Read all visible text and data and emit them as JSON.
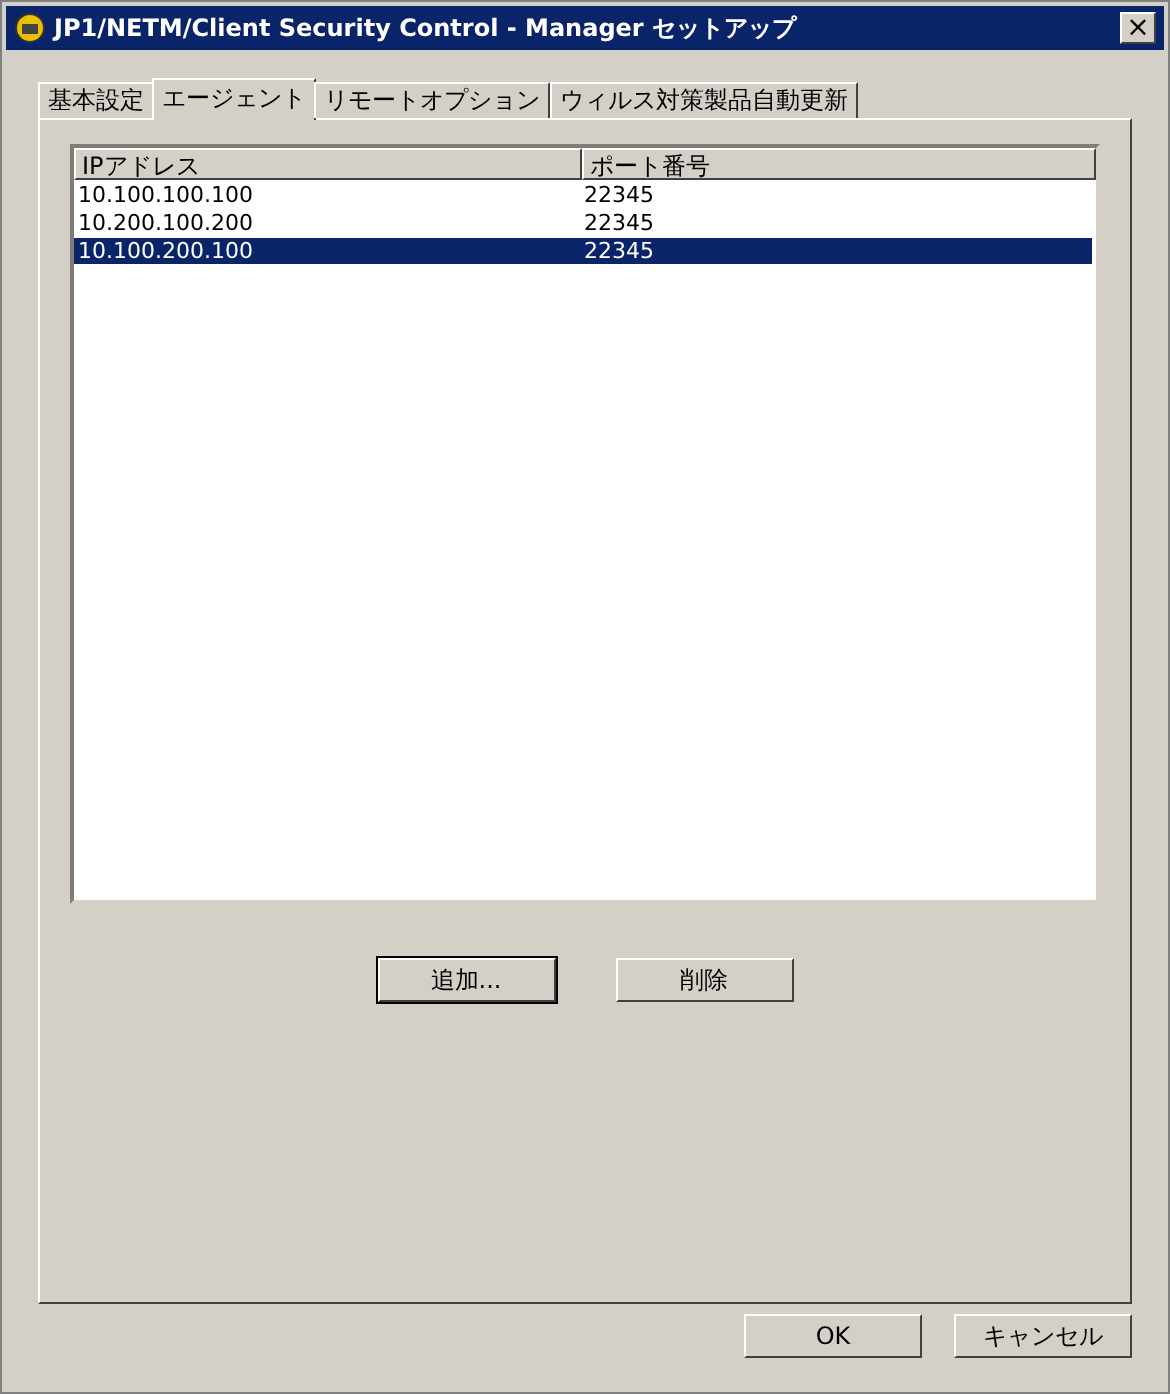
{
  "window": {
    "title": "JP1/NETM/Client Security Control - Manager セットアップ",
    "close": "×"
  },
  "tabs": [
    {
      "label": "基本設定",
      "selected": false
    },
    {
      "label": "エージェント",
      "selected": true
    },
    {
      "label": "リモートオプション",
      "selected": false
    },
    {
      "label": "ウィルス対策製品自動更新",
      "selected": false
    }
  ],
  "table": {
    "columns": [
      "IPアドレス",
      "ポート番号"
    ],
    "rows": [
      {
        "cells": [
          "10.100.100.100",
          "22345"
        ],
        "selected": false
      },
      {
        "cells": [
          "10.200.100.200",
          "22345"
        ],
        "selected": false
      },
      {
        "cells": [
          "10.100.200.100",
          "22345"
        ],
        "selected": true
      }
    ]
  },
  "panel_buttons": [
    {
      "label": "追加...",
      "default": true
    },
    {
      "label": "削除",
      "default": false
    }
  ],
  "buttons": [
    "OK",
    "キャンセル"
  ]
}
